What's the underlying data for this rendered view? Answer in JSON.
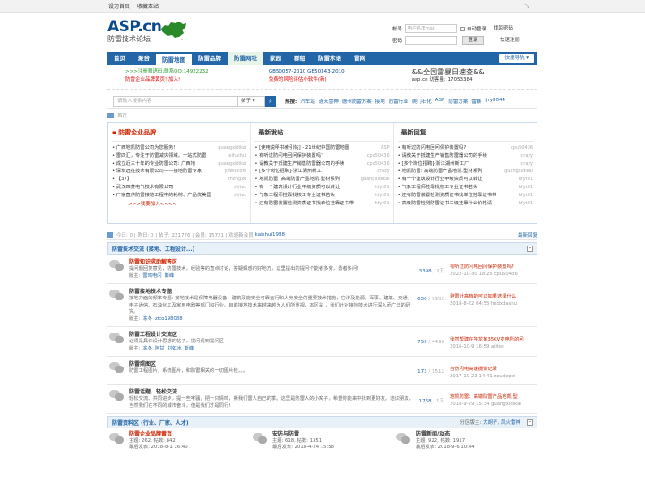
{
  "topbar": {
    "set_home": "设为首页",
    "bookmark": "收藏本站",
    "collapse_icon": "collapse-icon"
  },
  "logo": {
    "text": "ASP.cn",
    "subtitle": "防雷技术论坛"
  },
  "login": {
    "account_label": "帐号",
    "account_placeholder": "用户名/Email",
    "password_label": "密码",
    "password_value": "",
    "auto_login": "自动登录",
    "login_button": "登录",
    "forgot": "找回密码",
    "register": "快速注册"
  },
  "nav": {
    "items": [
      "首页",
      "聚合",
      "防雷地图",
      "防雷品牌",
      "防雷网址",
      "家园",
      "群组",
      "防雷术语",
      "雷网"
    ],
    "quick": "快捷导航"
  },
  "ads": {
    "col1_line1": ">>>注册赠语码:联系QQ:14922232",
    "col1_line2": "防雷企业品牌黄页! 加入!",
    "col2_line1": "GB50057-2010 GB50343-2010",
    "col2_line2": "免费的风险评估小软件(新)",
    "col3_line1": "&&全国雷暴日速查&&",
    "col3_line2": "asp.cn 访客量: 17053384"
  },
  "search": {
    "placeholder": "请输入搜索内容",
    "select": "帖子",
    "hot_label": "热搜:",
    "hot": [
      "汽车站",
      "通天雷神",
      "德州防雷方案",
      "接地",
      "防雷行业",
      "爬门石化",
      "ASP",
      "防雷方案",
      "雷暴",
      "ljry8044"
    ]
  },
  "breadcrumb": {
    "current": "首页"
  },
  "panel_left": {
    "title": "防雷企业品牌",
    "items": [
      {
        "t": "广西地凯防雷公司为您服务!",
        "a": "guangxidikai"
      },
      {
        "t": "雷四汇，专注于防雷减灾领域，一站式防雷",
        "a": "leihuihui"
      },
      {
        "t": "成立近三十年的专业防雷公司: 广西地",
        "a": "guangxidikai"
      },
      {
        "t": "深圳远征技术有限公司——接地防雷专家",
        "a": "yzwlecom"
      },
      {
        "t": "【37】",
        "a": "zhongxu"
      },
      {
        "t": "武汉四菱电气技术有限公司",
        "a": "atitec"
      },
      {
        "t": "厂家直供防雷接地工程中的耗材、产品优美国",
        "a": "atitec"
      }
    ],
    "more": ">>>我要加入<<<<"
  },
  "panel_mid": {
    "title": "最新发帖",
    "items": [
      {
        "t": "[使用说明书索引帖] - 21世纪中国防雷地图",
        "a": "ASP"
      },
      {
        "t": "有听过防闪电回问保护装置吗?",
        "a": "cpu50436"
      },
      {
        "t": "请教关于抵建生产销售防雷器公司的手续",
        "a": "cpu50436"
      },
      {
        "t": "[多个岗位招聘]-浙江湖州新工厂",
        "a": "crazy"
      },
      {
        "t": "地凯防雷: 高端防雷产品地凯.型材系列",
        "a": "guangxidikai"
      },
      {
        "t": "有一个建筑设计行业甲级资质可以转让",
        "a": "hfyt01"
      },
      {
        "t": "气象工程师挂靠找核工专业证书若头",
        "a": "hfyt01"
      },
      {
        "t": "还有防雷装置检测资质证书找单位挂靠证书带",
        "a": "hfyt01"
      }
    ]
  },
  "panel_right": {
    "title": "最新回复",
    "items": [
      {
        "t": "有听过防闪电回问保护装置吗?",
        "a": "cpu50436"
      },
      {
        "t": "请教关于抵建生产销售防雷器公司的手续",
        "a": "crazy"
      },
      {
        "t": "[多个岗位招聘]-浙江湖州新工厂",
        "a": "crazy"
      },
      {
        "t": "地凯防雷: 高端防雷产品地凯.型材系列",
        "a": "guangxidikai"
      },
      {
        "t": "有一个建筑设计行业甲级资质可以转让",
        "a": "hfyt01"
      },
      {
        "t": "气象工程师挂靠找核工专业证书若头",
        "a": "hfyt01"
      },
      {
        "t": "还有防雷装置检测资质证书找单位挂靠证书带",
        "a": "hfyt01"
      },
      {
        "t": "高级防雷检测防雷证书三级挂靠什么价格请",
        "a": "hfyt01"
      }
    ]
  },
  "stats": {
    "text": "今日: 0 | 昨日: 0 | 帖子: 221776 | 会员: 15721 | 欢迎新会员:",
    "new_member": "kaishui1988",
    "latest_reply": "最新回复"
  },
  "group1": {
    "title": "防雷技术交流 (接地、工程设计...)",
    "forums": [
      {
        "name": "防雷知识求助解答区",
        "red": true,
        "desc": "提问题回复意见，防雷技术，经验等的直点讨论，答疑解惑的好地方，这里提出的提问个能者多劳，勇者多问!",
        "mods_label": "版主:",
        "mods": [
          "雷鸣电闪",
          "斯峰"
        ],
        "count": "3398",
        "count_total": "2万",
        "last_title": "有听过防闪电回问保护装置吗?",
        "last_meta": "2022-10-30 18:25 cpu50436"
      },
      {
        "name": "防雷接地技术专题",
        "red": false,
        "desc": "接地力面的频率专题: 接地技术是保障电器设备、建筑及施安全可靠运行和人身安全的重要技术措施，它涉及能源、军事、建筑、交通、电子通信、石油化工及家用电器等部门和行业。目前接地技术来越来越为人们所重视，本区是 ，我们针对接地技术进行深入而广泛的研究。",
        "mods_label": "版主:",
        "mods": [
          "冻冬",
          "zico198088"
        ],
        "count": "650",
        "count_total": "9952",
        "last_title": "避雷针高档的可以如果选择什么",
        "last_meta": "2018-8-22 04:55 hxdxdashu"
      },
      {
        "name": "防雷工程设计交流区",
        "red": false,
        "desc": "必须是具体设计思想的帖子，提问请到提问区",
        "mods_label": "版主:",
        "mods": [
          "冻冬",
          "阿甘",
          "刘如冰",
          "斯峰"
        ],
        "count": "759",
        "count_total": "4490",
        "last_title": "我然帮建在学龙某35KV变电所的问",
        "last_meta": "2016-10-9 16:59 atitec"
      },
      {
        "name": "防雷照图区",
        "red": false,
        "desc": "防雷工程图片，系统图片，和防雷相关的一切图片检。。。",
        "mods_label": "",
        "mods": [],
        "count": "173",
        "count_total": "1512",
        "last_title": "自伤闪电高速摄像记录",
        "last_meta": "2017-10-23 14:41 zoudepei"
      },
      {
        "name": "防雷话题、轻松交流",
        "red": false,
        "desc": "轻松交流、共同进步，提一些牢骚，把一只情鸣，撕我们雷人自己的季。这里是防雷人的小窝子，希望你能来中找到更好友。结识朋友，当然我们在不同的城市奋斗，但是我们才是同行!",
        "mods_label": "",
        "mods": [],
        "count": "1768",
        "count_total": "1万",
        "last_title": "地凯防雷：高端防雷产品地凯.型 ",
        "last_meta": "2018-9-29 15:34 guangxidikai"
      }
    ]
  },
  "group2": {
    "title": "防雷资料区 (行业、厂家、人才)",
    "mod_label": "分区版主:",
    "mods": "大胡子, 风火雷神",
    "cards": [
      {
        "name": "防雷企业品牌黄页",
        "red": true,
        "l1": "主题: 262, 帖数: 842",
        "l2": "最后发表: 2018-8-1 16:40"
      },
      {
        "name": "安防与防雷",
        "red": false,
        "l1": "主题: 618, 帖数: 1351",
        "l2": "最后发表: 2018-4-24 15:58"
      },
      {
        "name": "防雷新闻/动态",
        "red": false,
        "l1": "主题: 922, 帖数: 1917",
        "l2": "最后发表: 2018-9-6 10:44"
      }
    ]
  },
  "colors": {
    "nav_blue": "#2366a8",
    "brand_red": "#cc2200",
    "link_blue": "#2366a8"
  }
}
